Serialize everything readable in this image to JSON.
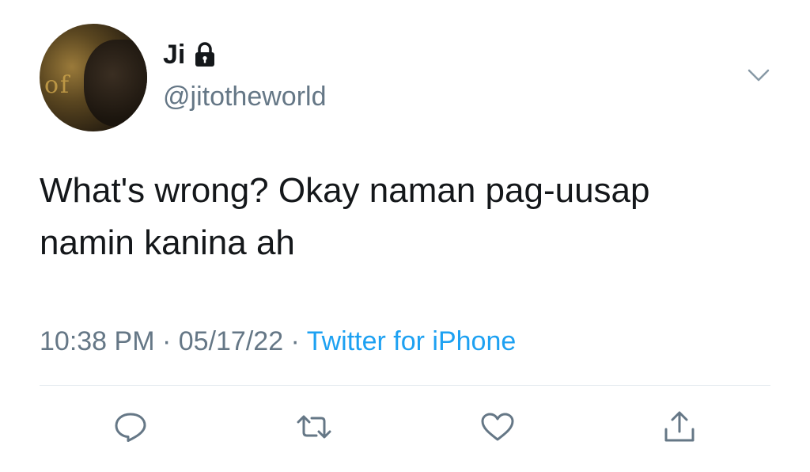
{
  "user": {
    "display_name": "Ji",
    "handle": "@jitotheworld",
    "protected_icon": "lock-icon",
    "avatar_icon": "avatar"
  },
  "tweet": {
    "text": "What's wrong? Okay naman pag-uusap namin kanina ah",
    "time": "10:38 PM",
    "separator": " · ",
    "date": "05/17/22",
    "source": "Twitter for iPhone"
  },
  "actions": {
    "reply_icon": "reply-icon",
    "retweet_icon": "retweet-icon",
    "like_icon": "heart-icon",
    "share_icon": "share-icon",
    "more_icon": "chevron-down-icon"
  },
  "colors": {
    "text": "#14171a",
    "secondary": "#657786",
    "link": "#1da1f2",
    "divider": "#e1e8ed"
  }
}
